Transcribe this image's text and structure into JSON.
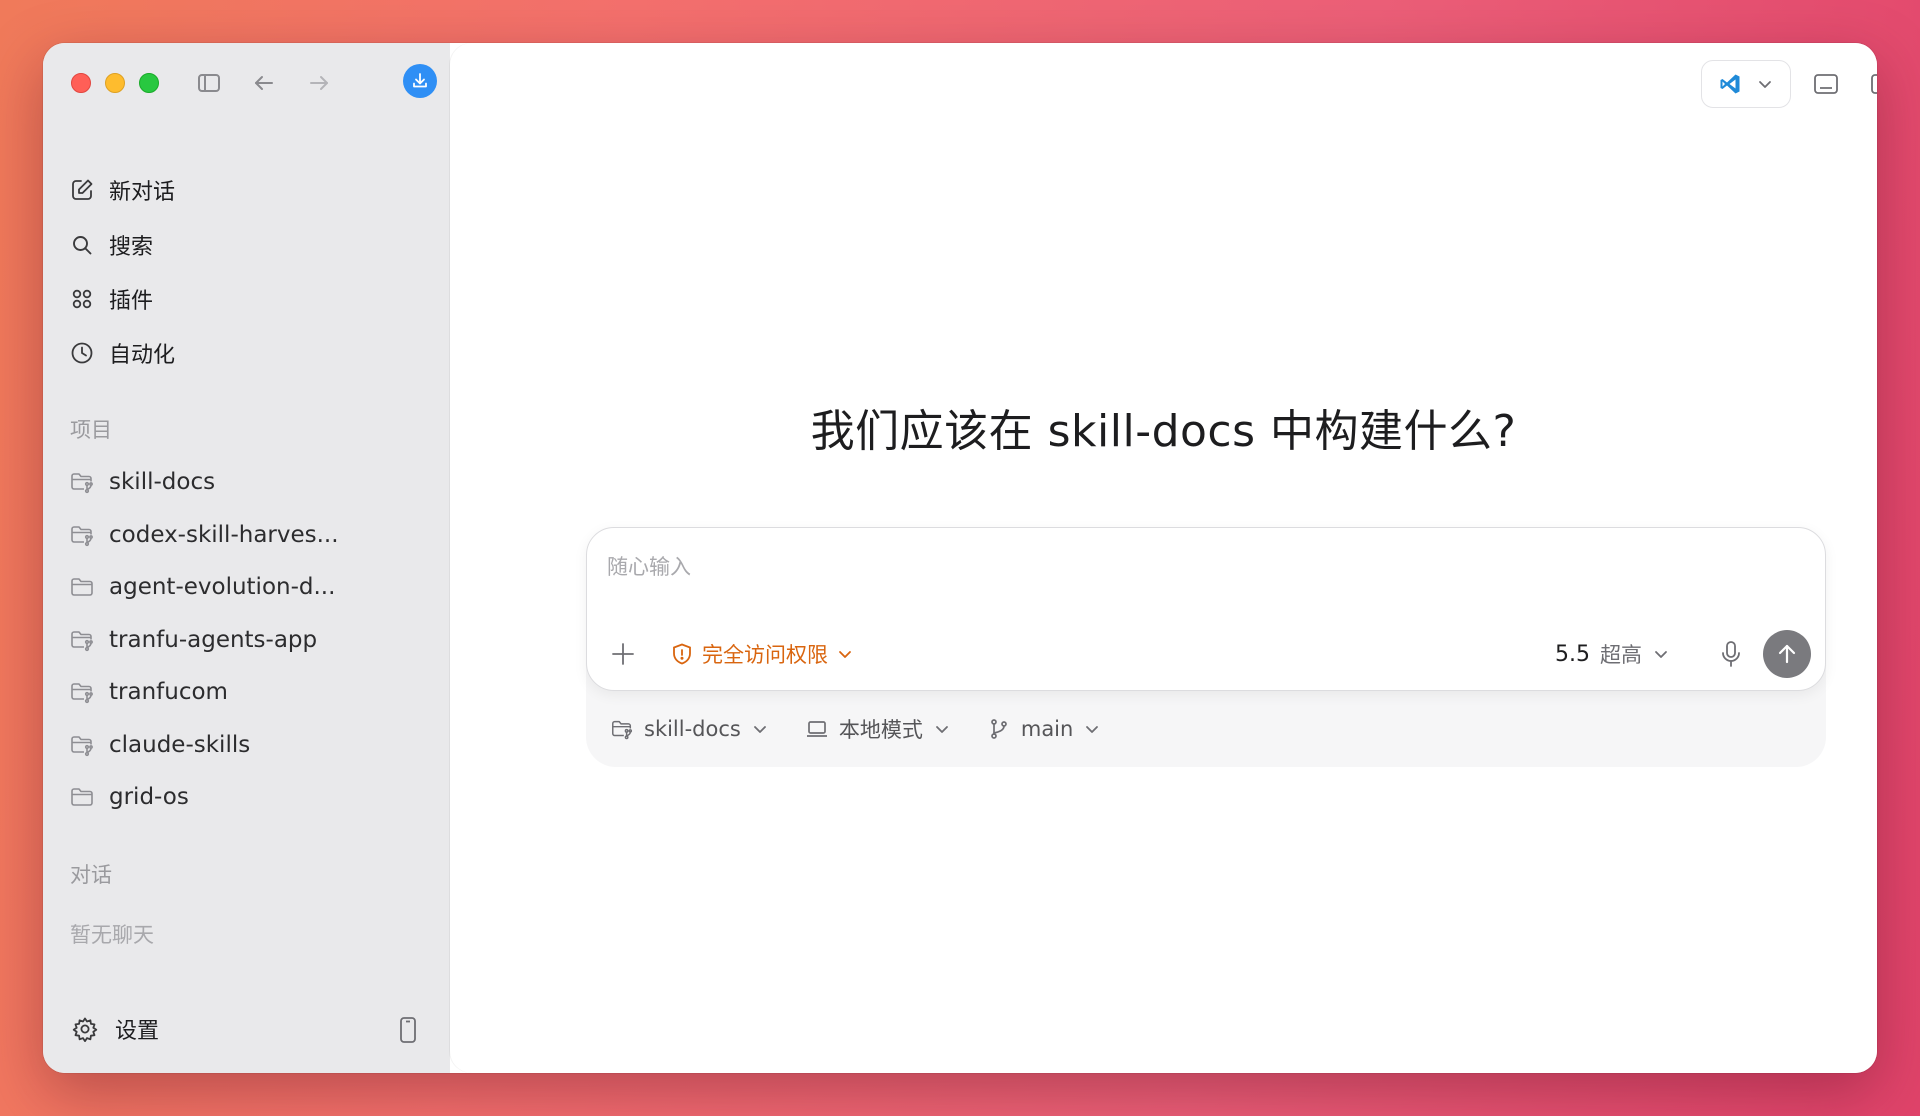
{
  "window": {
    "controls": [
      "close",
      "minimize",
      "zoom"
    ]
  },
  "sidebar": {
    "nav": [
      {
        "label": "新对话",
        "icon": "compose-icon"
      },
      {
        "label": "搜索",
        "icon": "search-icon"
      },
      {
        "label": "插件",
        "icon": "plugins-icon"
      },
      {
        "label": "自动化",
        "icon": "clock-icon"
      }
    ],
    "projects_label": "项目",
    "projects": [
      {
        "label": "skill-docs",
        "icon": "git-folder-icon"
      },
      {
        "label": "codex-skill-harves...",
        "icon": "git-folder-icon"
      },
      {
        "label": "agent-evolution-d...",
        "icon": "folder-icon"
      },
      {
        "label": "tranfu-agents-app",
        "icon": "git-folder-icon"
      },
      {
        "label": "tranfucom",
        "icon": "git-folder-icon"
      },
      {
        "label": "claude-skills",
        "icon": "git-folder-icon"
      },
      {
        "label": "grid-os",
        "icon": "folder-icon"
      }
    ],
    "chats_label": "对话",
    "chats_empty": "暂无聊天",
    "settings_label": "设置"
  },
  "main": {
    "headline": "我们应该在 skill-docs 中构建什么?",
    "composer": {
      "placeholder": "随心输入",
      "value": "",
      "access_label": "完全访问权限",
      "model_version": "5.5",
      "model_level": "超高"
    },
    "meta": {
      "project": "skill-docs",
      "mode": "本地模式",
      "branch": "main"
    }
  },
  "colors": {
    "accent_blue": "#2f8ff5",
    "warning_orange": "#d9650f",
    "send_button": "#7a7a7e",
    "sidebar_bg": "#e9e9eb"
  }
}
